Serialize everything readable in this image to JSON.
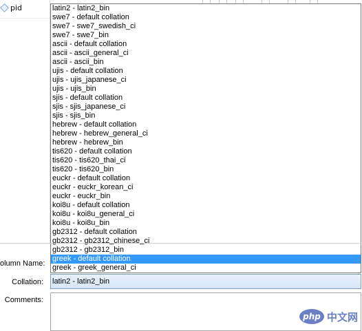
{
  "tree": {
    "item_label": "pid"
  },
  "dropdown": {
    "items": [
      {
        "label": "latin2 - latin2_bin",
        "selected": false
      },
      {
        "label": "swe7 - default collation",
        "selected": false
      },
      {
        "label": "swe7 - swe7_swedish_ci",
        "selected": false
      },
      {
        "label": "swe7 - swe7_bin",
        "selected": false
      },
      {
        "label": "ascii - default collation",
        "selected": false
      },
      {
        "label": "ascii - ascii_general_ci",
        "selected": false
      },
      {
        "label": "ascii - ascii_bin",
        "selected": false
      },
      {
        "label": "ujis - default collation",
        "selected": false
      },
      {
        "label": "ujis - ujis_japanese_ci",
        "selected": false
      },
      {
        "label": "ujis - ujis_bin",
        "selected": false
      },
      {
        "label": "sjis - default collation",
        "selected": false
      },
      {
        "label": "sjis - sjis_japanese_ci",
        "selected": false
      },
      {
        "label": "sjis - sjis_bin",
        "selected": false
      },
      {
        "label": "hebrew - default collation",
        "selected": false
      },
      {
        "label": "hebrew - hebrew_general_ci",
        "selected": false
      },
      {
        "label": "hebrew - hebrew_bin",
        "selected": false
      },
      {
        "label": "tis620 - default collation",
        "selected": false
      },
      {
        "label": "tis620 - tis620_thai_ci",
        "selected": false
      },
      {
        "label": "tis620 - tis620_bin",
        "selected": false
      },
      {
        "label": "euckr - default collation",
        "selected": false
      },
      {
        "label": "euckr - euckr_korean_ci",
        "selected": false
      },
      {
        "label": "euckr - euckr_bin",
        "selected": false
      },
      {
        "label": "koi8u - default collation",
        "selected": false
      },
      {
        "label": "koi8u - koi8u_general_ci",
        "selected": false
      },
      {
        "label": "koi8u - koi8u_bin",
        "selected": false
      },
      {
        "label": "gb2312 - default collation",
        "selected": false
      },
      {
        "label": "gb2312 - gb2312_chinese_ci",
        "selected": false
      },
      {
        "label": "gb2312 - gb2312_bin",
        "selected": false
      },
      {
        "label": "greek - default collation",
        "selected": true
      },
      {
        "label": "greek - greek_general_ci",
        "selected": false
      }
    ]
  },
  "form": {
    "column_name_label": "olumn Name:",
    "collation_label": "Collation:",
    "collation_value": "latin2 - latin2_bin",
    "comments_label": "Comments:",
    "comments_value": ""
  },
  "watermark": {
    "oval_text": "php",
    "text": "中文网"
  },
  "colors": {
    "selection": "#3399ff",
    "accent": "#6a7fc4"
  }
}
